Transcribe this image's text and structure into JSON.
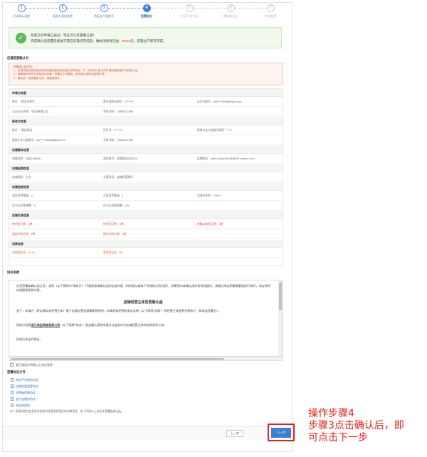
{
  "stepper": {
    "steps": [
      {
        "num": "1",
        "label": "开店确认流程"
      },
      {
        "num": "2",
        "label": "接收方身份核验"
      },
      {
        "num": "3",
        "label": "验证支付宝账号"
      },
      {
        "num": "4",
        "label": "签署协议"
      },
      {
        "num": "5",
        "label": "验证手机号码"
      },
      {
        "num": "6",
        "label": "缴纳保证金"
      },
      {
        "num": "7",
        "label": "完成变更"
      }
    ]
  },
  "notice": {
    "line1": "您提交的申请已通过，现在可以签署确认函！",
    "line2_prefix": "完成确认函签署后接收方需在您操作完成后：缴纳消保保证金：",
    "line2_amount": "¥0.01",
    "line2_suffix": "元，店铺过户即可完成。"
  },
  "confirm_section": {
    "title": "店铺变更确认书"
  },
  "warning": {
    "lines": [
      "签署确认函须知：",
      "1、店铺变更后原店铺主体的店铺经营资质(经营主体变更)，下一步将进入新主体开通店铺经营许可权及认证。",
      "2、请确保所有填写信息真实准确，签署后不可撤回，如有疑问请联系客服处理。",
      "3、确认函一经签署即生效，请谨慎操作。"
    ]
  },
  "info": {
    "bands": [
      "申请方信息",
      "接收方信息",
      "店铺基本信息",
      "店铺经营信息",
      "店铺信誉信息",
      "店铺交易信息",
      "消费信息"
    ],
    "rows": [
      [
        "姓名：*测试名称号",
        "营业执照注册号：3*****3",
        "支付宝账号：ata****344@aliasd.com"
      ],
      [
        "认证企业名称：*测试有限公司",
        "手机号码：13588112365",
        ""
      ],
      [
        "姓名：*测试测试",
        "证件号：3*****1",
        "接收方支付宝账号类型：个人"
      ],
      [
        "接收方支付宝账号：aw*****383@aliasd.com",
        "手机号码：13588112365",
        ""
      ],
      [
        "店铺名称：试店1388461",
        "淘宝账号：店铺测试试店123",
        "店铺地址：https://shop3613888461.taobao.com"
      ],
      [
        "店铺类型：企业",
        "主营类目：店铺经营类目",
        ""
      ],
      [
        "卖家信用等级：0",
        "买家信用等级：1",
        "卖家好评率：100%"
      ],
      [
        "近30天交易笔数：0",
        "近30天交易金额：0%",
        ""
      ],
      [
        "待付款订单：0单",
        "待发货订单：0单",
        "待确认收货订单：0单"
      ],
      [
        "退款中的订单：0单",
        "售后中的订单：0单",
        ""
      ],
      [
        "消保保证金：¥0.01",
        "类型保证金：¥0",
        ""
      ]
    ]
  },
  "agreement": {
    "title": "协议条款",
    "intro": "在您签署本确认函之前，请您（以下简称为“接收方”）仔细阅读本确认函的全部内容（特别是以粗体下划线标注的内容），如果您对本确认函的条款有疑问，请通过淘宝网客服渠道进行询问，淘宝网将向您解释条款内容。",
    "center_title": "店铺经营主体变更确认函",
    "p2": "鉴于，申请方（原店铺实际经营主体）基于店铺运营发展需要等原因，申请将其经营的淘宝店铺（以下简称“店铺”）的经营主体变更为接收方（即本函签署方）。",
    "p3_prefix": "接收方同意",
    "p3_company": "浙江淘宝网络有限公司",
    "p3_suffix": "（以下简称“淘宝”）提出确认接受申请方在此前作为店铺经营主体的相关权利义务。",
    "p4": "接收方承诺并保证："
  },
  "confirm_check": "我已阅读并同意以上协议条款",
  "docs": {
    "title": "签署协议文件",
    "items": [
      "淘宝平台服务协议",
      "店铺经营变更协议",
      "消费者保障协议",
      "支付宝服务协议",
      "淘宝网规则"
    ]
  },
  "footnote": "本人承诺所提交信息真实有效并愿意承担相应的法律责任，本人同意以上协议并签署此确认函。",
  "buttons": {
    "prev": "上一步",
    "next": "下一步"
  },
  "annotation": {
    "line1": "操作步骤4",
    "line2": "步骤3点击确认后，即",
    "line3": "可点击下一步"
  },
  "colors": {
    "primary_blue": "#3e7fd6",
    "highlight_red": "#e0201c",
    "success_green": "#5cb85c",
    "amount_orange": "#e8631f"
  }
}
